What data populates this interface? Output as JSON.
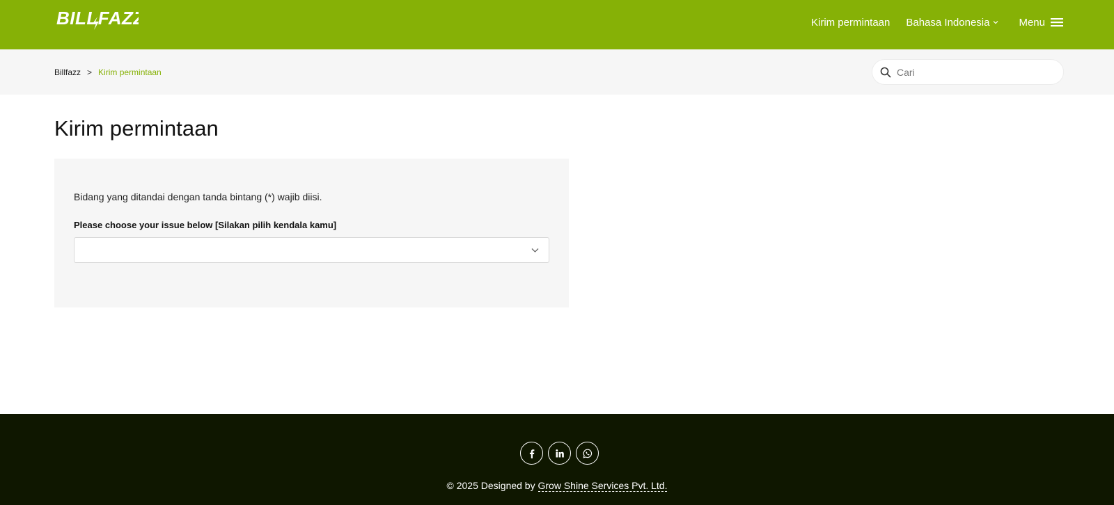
{
  "header": {
    "logo_text": "BILLFAZZ",
    "nav": {
      "submit_request": "Kirim permintaan",
      "language": "Bahasa Indonesia",
      "menu": "Menu"
    }
  },
  "subheader": {
    "breadcrumb": {
      "root": "Billfazz",
      "separator": ">",
      "current": "Kirim permintaan"
    },
    "search": {
      "placeholder": "Cari"
    }
  },
  "main": {
    "title": "Kirim permintaan",
    "form": {
      "required_note": "Bidang yang ditandai dengan tanda bintang (*) wajib diisi.",
      "issue_label": "Please choose your issue below [Silakan pilih kendala kamu]",
      "issue_value": ""
    }
  },
  "footer": {
    "social_icons": [
      "facebook-icon",
      "linkedin-icon",
      "whatsapp-icon"
    ],
    "copyright_prefix": "© 2025 Designed by",
    "company": "Grow Shine Services Pvt. Ltd."
  },
  "colors": {
    "brand_green": "#86b106",
    "footer_bg": "#0f1700",
    "subbar_bg": "#f6f6f6"
  }
}
